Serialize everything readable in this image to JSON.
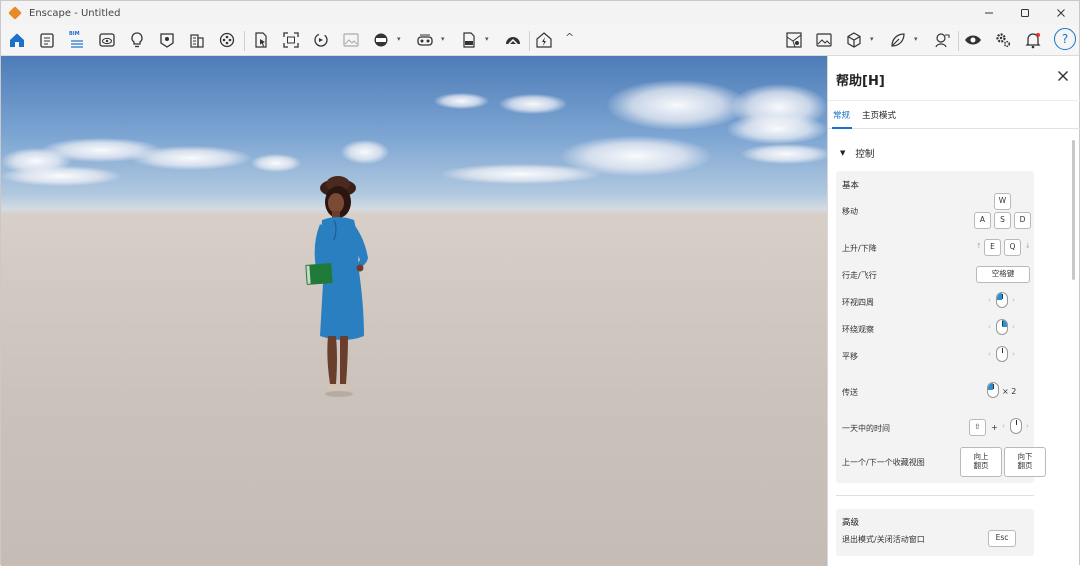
{
  "window": {
    "title": "Enscape - Untitled"
  },
  "toolbar": {
    "bim_label": "BIM",
    "collapse_label": "^",
    "help_label": "?"
  },
  "panel": {
    "title": "帮助[H]",
    "tabs": [
      {
        "label": "常规"
      },
      {
        "label": "主页模式"
      }
    ],
    "controls_section": "控制",
    "basic": {
      "title": "基本",
      "move": {
        "label": "移动",
        "keys": [
          "W",
          "A",
          "S",
          "D"
        ]
      },
      "updown": {
        "label": "上升/下降",
        "keys": [
          "E",
          "Q"
        ]
      },
      "walkfly": {
        "label": "行走/飞行",
        "key": "空格键"
      },
      "lookaround": {
        "label": "环视四周"
      },
      "orbit": {
        "label": "环绕观察"
      },
      "pan": {
        "label": "平移"
      },
      "teleport": {
        "label": "传送",
        "suffix": "× 2"
      },
      "timeofday": {
        "label": "一天中的时间",
        "plus": "+"
      },
      "bookmarks": {
        "label": "上一个/下一个收藏视图",
        "keys": [
          "向上\n翻页",
          "向下\n翻页"
        ]
      }
    },
    "advanced": {
      "title": "高级",
      "exit": {
        "label": "退出模式/关闭活动窗口",
        "key": "Esc"
      }
    }
  },
  "colors": {
    "accent": "#1a73c8",
    "dress": "#2a7fc0",
    "book": "#1f7a3a"
  }
}
